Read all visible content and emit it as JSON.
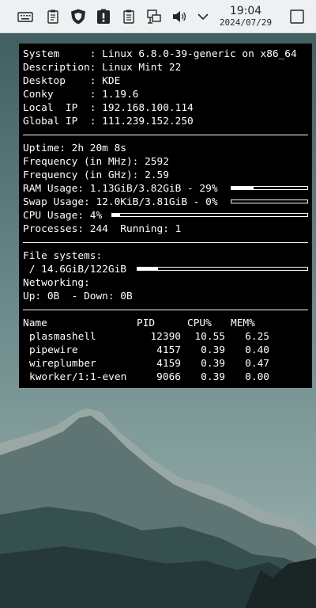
{
  "panel": {
    "icons": [
      "keyboard-icon",
      "clipboard-icon",
      "shield-icon",
      "notification-clipboard-icon",
      "clipboard-list-icon",
      "network-wired-icon",
      "volume-icon",
      "chevron-down-icon"
    ],
    "clock": {
      "time": "19:04",
      "date": "2024/07/29"
    },
    "show_desktop": "show-desktop-icon"
  },
  "conky": {
    "system_rows": [
      {
        "label": "System     : ",
        "value": "Linux 6.8.0-39-generic on x86_64"
      },
      {
        "label": "Description: ",
        "value": "Linux Mint 22"
      },
      {
        "label": "Desktop    : ",
        "value": "KDE"
      },
      {
        "label": "Conky      : ",
        "value": "1.19.6"
      },
      {
        "label": "Local  IP  : ",
        "value": "192.168.100.114"
      },
      {
        "label": "Global IP  : ",
        "value": "111.239.152.250"
      }
    ],
    "uptime": {
      "label": "Uptime: ",
      "value": "2h 20m 8s"
    },
    "freq_mhz": {
      "label": "Frequency (in MHz): ",
      "value": "2592"
    },
    "freq_ghz": {
      "label": "Frequency (in GHz): ",
      "value": "2.59"
    },
    "ram": {
      "label": "RAM Usage: ",
      "value": "1.13GiB/3.82GiB - 29%",
      "fraction": 0.29
    },
    "swap": {
      "label": "Swap Usage: ",
      "value": "12.0KiB/3.81GiB - 0%",
      "fraction": 0.0
    },
    "cpu": {
      "label": "CPU Usage: ",
      "value": "4%",
      "fraction": 0.04
    },
    "processes": {
      "label": "Processes: ",
      "value": "244",
      "running_label": "  Running: ",
      "running_value": "1"
    },
    "filesystems": {
      "label": "File systems:",
      "root": " / 14.6GiB/122GiB",
      "fraction": 0.12
    },
    "networking": {
      "label": "Networking:",
      "up_label": "Up: ",
      "up_value": "0B",
      "down_label": "  - Down: ",
      "down_value": "0B"
    },
    "table": {
      "headers": [
        "Name",
        "PID",
        "CPU%",
        "MEM%"
      ],
      "rows": [
        [
          "plasmashell",
          "12390",
          "10.55",
          "6.25"
        ],
        [
          "pipewire",
          "4157",
          "0.39",
          "0.40"
        ],
        [
          "wireplumber",
          "4159",
          "0.39",
          "0.47"
        ],
        [
          "kworker/1:1-even",
          "9066",
          "0.39",
          "0.00"
        ]
      ]
    }
  }
}
